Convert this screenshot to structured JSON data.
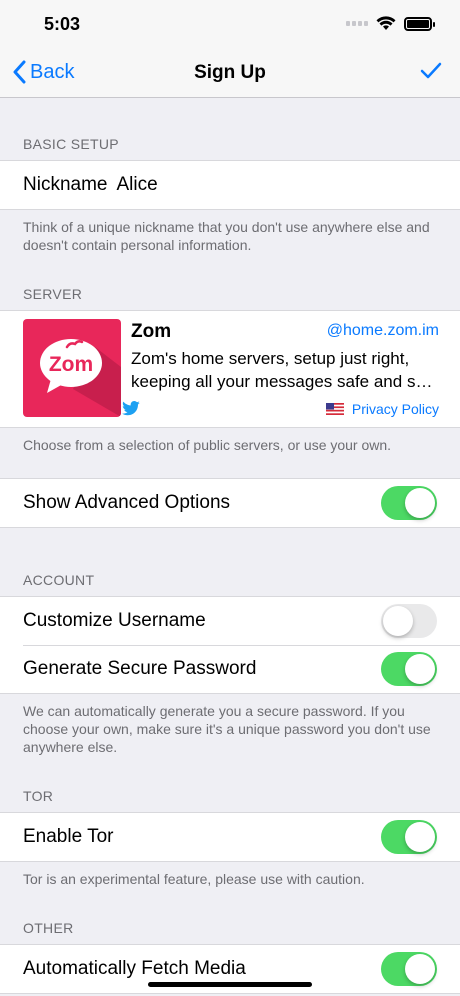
{
  "status_bar": {
    "time": "5:03"
  },
  "nav": {
    "back_label": "Back",
    "title": "Sign Up"
  },
  "basic_setup": {
    "header": "BASIC SETUP",
    "nickname_label": "Nickname",
    "nickname_value": "Alice",
    "footer": "Think of a unique nickname that you don't use anywhere else and doesn't contain personal information."
  },
  "server": {
    "header": "SERVER",
    "name": "Zom",
    "domain": "@home.zom.im",
    "description_line1": "Zom's home servers, setup just right,",
    "description_line2": "keeping all your messages safe and so...",
    "logo_text": "Zom",
    "privacy_label": "Privacy Policy",
    "footer": "Choose from a selection of public servers, or use your own."
  },
  "advanced": {
    "label": "Show Advanced Options",
    "on": true
  },
  "account": {
    "header": "ACCOUNT",
    "customize_label": "Customize Username",
    "customize_on": false,
    "generate_label": "Generate Secure Password",
    "generate_on": true,
    "footer": "We can automatically generate you a secure password. If you choose your own, make sure it's a unique password you don't use anywhere else."
  },
  "tor": {
    "header": "TOR",
    "label": "Enable Tor",
    "on": true,
    "footer": "Tor is an experimental feature, please use with caution."
  },
  "other": {
    "header": "OTHER",
    "fetch_label": "Automatically Fetch Media",
    "fetch_on": true
  },
  "colors": {
    "accent": "#0a7aff",
    "toggle_on": "#4cd964",
    "brand": "#e8275a"
  }
}
